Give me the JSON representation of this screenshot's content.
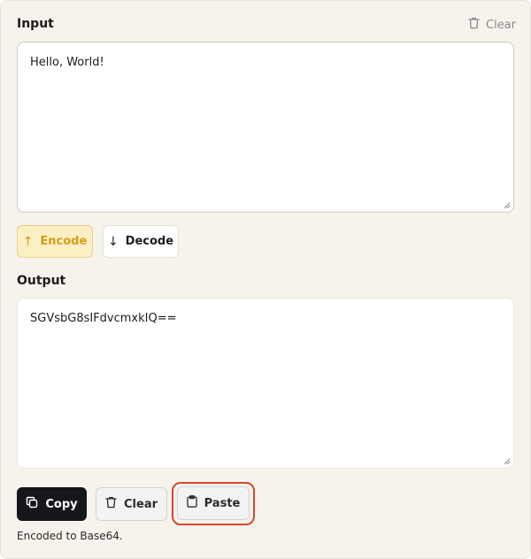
{
  "input": {
    "label": "Input",
    "clear_label": "Clear",
    "value": "Hello, World!"
  },
  "actions": {
    "encode_arrow": "↑",
    "encode_label": "Encode",
    "decode_arrow": "↓",
    "decode_label": "Decode"
  },
  "output": {
    "label": "Output",
    "value": "SGVsbG8sIFdvcmxkIQ=="
  },
  "output_actions": {
    "copy_label": "Copy",
    "clear_label": "Clear",
    "paste_label": "Paste"
  },
  "status": {
    "message": "Encoded to Base64."
  },
  "icons": {
    "header_clear": "trash-icon",
    "copy": "copy-icon",
    "clear": "trash-icon",
    "paste": "clipboard-icon"
  },
  "colors": {
    "panel_bg": "#f6f3ec",
    "encode_bg": "#fcefc4",
    "encode_text": "#d49c1a",
    "copy_bg": "#15171b",
    "highlight_ring": "#d9452f"
  }
}
